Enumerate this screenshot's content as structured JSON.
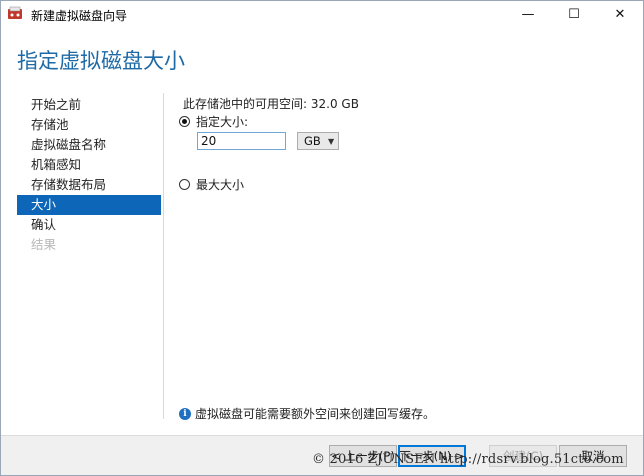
{
  "window": {
    "title": "新建虚拟磁盘向导",
    "minimize_glyph": "—",
    "maximize_glyph": "☐",
    "close_glyph": "✕"
  },
  "header": {
    "title": "指定虚拟磁盘大小"
  },
  "nav": {
    "items": [
      {
        "label": "开始之前",
        "state": "normal"
      },
      {
        "label": "存储池",
        "state": "normal"
      },
      {
        "label": "虚拟磁盘名称",
        "state": "normal"
      },
      {
        "label": "机箱感知",
        "state": "normal"
      },
      {
        "label": "存储数据布局",
        "state": "normal"
      },
      {
        "label": "大小",
        "state": "active"
      },
      {
        "label": "确认",
        "state": "normal"
      },
      {
        "label": "结果",
        "state": "disabled"
      }
    ]
  },
  "content": {
    "available_space": "此存储池中的可用空间: 32.0 GB",
    "specify_size_label": "指定大小:",
    "specify_size_selected": true,
    "size_value": "20",
    "unit_selected": "GB",
    "max_size_label": "最大大小",
    "max_size_selected": false,
    "info_text": "虚拟磁盘可能需要额外空间来创建回写缓存。"
  },
  "footer": {
    "prev_label": "< 上一步(P)",
    "next_label": "下一步(N) >",
    "create_label": "创建(C)",
    "cancel_label": "取消"
  },
  "watermark": "© 2016 ZJUNSEN http://rdsrv.blog.51cto.com",
  "colors": {
    "accent": "#0e66b8",
    "header_text": "#1e6aa7",
    "info_icon": "#1f70c1"
  },
  "icons": {
    "app": "virtual-disk-wizard-icon",
    "info": "info-icon",
    "unit_dropdown": "chevron-down-icon"
  }
}
